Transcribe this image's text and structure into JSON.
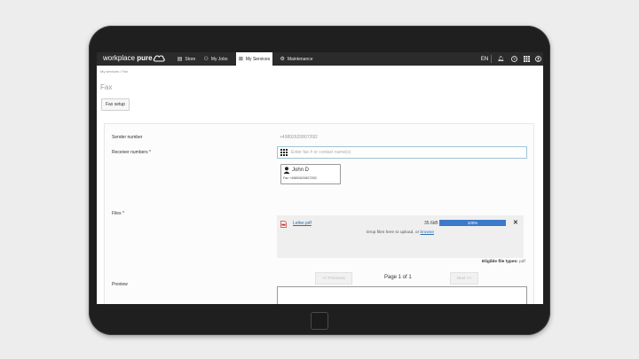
{
  "brand": {
    "prefix": "workplace ",
    "name": "pure"
  },
  "nav": {
    "items": [
      {
        "label": "Store",
        "icon": "store-icon"
      },
      {
        "label": "My Jobs",
        "icon": "jobs-icon"
      },
      {
        "label": "My Services",
        "icon": "services-icon",
        "active": true
      },
      {
        "label": "Maintenance",
        "icon": "gear-icon"
      }
    ],
    "language": "EN",
    "right_icons": [
      "bell-icon",
      "help-icon",
      "apps-grid-icon",
      "user-icon"
    ]
  },
  "breadcrumb": "My services / Fax",
  "page_title": "Fax",
  "fax_setup_label": "Fax setup",
  "form": {
    "sender_label": "Sender number",
    "sender_value": "+4989262080720l2",
    "receiver_label": "Receiver numbers *",
    "receiver_placeholder": "Enter fax # or contact name(s)",
    "contact": {
      "name": "John D",
      "fax": "Fax +4989262080720l2"
    },
    "files_label": "Files *",
    "file": {
      "name": "Letter.pdf",
      "size": "35.6kB",
      "progress_percent": 100,
      "progress_label": "100%"
    },
    "drop_text": "Drop files here to upload, or",
    "drop_link": "browse",
    "eligible_label": "Eligible file types:",
    "eligible_ext": "pdf",
    "preview_label": "Preview",
    "prev_label": "<< Previous",
    "next_label": "Next >>",
    "page_info": "Page 1 of 1"
  },
  "colors": {
    "nav_bg": "#2b2b2b",
    "accent": "#3d79c9",
    "link": "#2f6fb0"
  }
}
